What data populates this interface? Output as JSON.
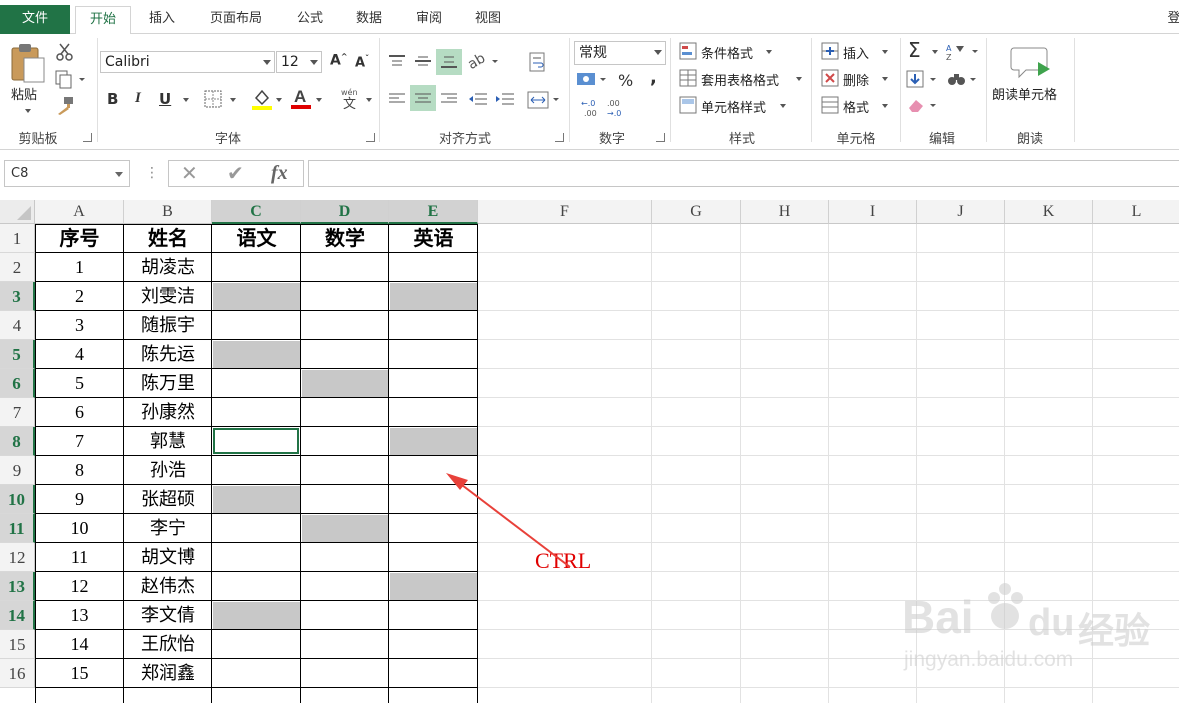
{
  "ribbon": {
    "tabs": [
      "文件",
      "开始",
      "插入",
      "页面布局",
      "公式",
      "数据",
      "审阅",
      "视图"
    ],
    "account_label": "登",
    "clipboard": {
      "paste_label": "粘贴",
      "group_label": "剪贴板"
    },
    "font": {
      "font_name": "Calibri",
      "font_size": "12",
      "bold": "B",
      "italic": "I",
      "underline": "U",
      "group_label": "字体",
      "phonetic_glyph": "wén",
      "font_color": "#e00000",
      "fill_color": "#ffff00"
    },
    "alignment": {
      "group_label": "对齐方式"
    },
    "number": {
      "format": "常规",
      "percent": "%",
      "comma": ",",
      "group_label": "数字"
    },
    "styles": {
      "conditional": "条件格式",
      "table_format": "套用表格格式",
      "cell_styles": "单元格样式",
      "group_label": "样式"
    },
    "cells": {
      "insert": "插入",
      "delete": "删除",
      "format": "格式",
      "group_label": "单元格"
    },
    "editing": {
      "group_label": "编辑"
    },
    "read": {
      "read_cell": "朗读单元格",
      "group_label": "朗读"
    }
  },
  "formula_bar": {
    "name_box": "C8",
    "fx": "fx",
    "cancel": "✕",
    "enter": "✔",
    "content": ""
  },
  "sheet": {
    "columns": [
      "A",
      "B",
      "C",
      "D",
      "E",
      "F",
      "G",
      "H",
      "I",
      "J",
      "K",
      "L"
    ],
    "selected_columns": [
      "C",
      "D",
      "E"
    ],
    "rows": [
      "1",
      "2",
      "3",
      "4",
      "5",
      "6",
      "7",
      "8",
      "9",
      "10",
      "11",
      "12",
      "13",
      "14",
      "15",
      "16"
    ],
    "selected_rows": [
      "3",
      "5",
      "6",
      "8",
      "10",
      "11",
      "13",
      "14"
    ],
    "header": [
      "序号",
      "姓名",
      "语文",
      "数学",
      "英语"
    ],
    "data": [
      [
        "1",
        "胡凌志"
      ],
      [
        "2",
        "刘雯洁"
      ],
      [
        "3",
        "随振宇"
      ],
      [
        "4",
        "陈先运"
      ],
      [
        "5",
        "陈万里"
      ],
      [
        "6",
        "孙康然"
      ],
      [
        "7",
        "郭慧"
      ],
      [
        "8",
        "孙浩"
      ],
      [
        "9",
        "张超硕"
      ],
      [
        "10",
        "李宁"
      ],
      [
        "11",
        "胡文博"
      ],
      [
        "12",
        "赵伟杰"
      ],
      [
        "13",
        "李文倩"
      ],
      [
        "14",
        "王欣怡"
      ],
      [
        "15",
        "郑润鑫"
      ]
    ],
    "selected_cells": [
      "C3",
      "E3",
      "C5",
      "D6",
      "E8",
      "C10",
      "D11",
      "E13",
      "C14"
    ],
    "active_cell": "C8",
    "annotation": "CTRL"
  },
  "watermark": {
    "brand": "Bai",
    "brand2": "du",
    "product": "经验",
    "url": "jingyan.baidu.com"
  }
}
